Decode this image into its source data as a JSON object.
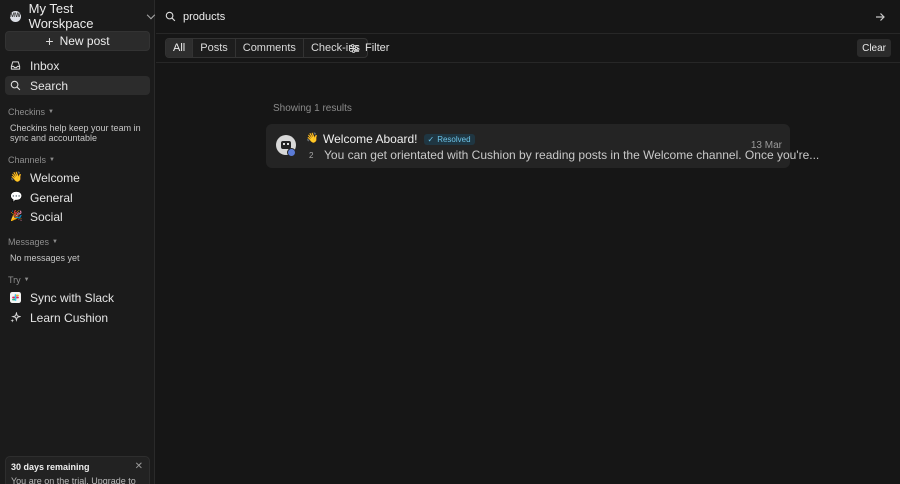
{
  "workspace": {
    "logo_text": "MW",
    "name": "My Test Worskpace"
  },
  "sidebar": {
    "new_post_label": "New post",
    "nav": [
      {
        "label": "Inbox",
        "icon": "inbox-icon"
      },
      {
        "label": "Search",
        "icon": "search-icon"
      }
    ],
    "checkins": {
      "heading": "Checkins",
      "note": "Checkins help keep your team in sync and accountable"
    },
    "channels": {
      "heading": "Channels",
      "items": [
        {
          "emoji": "👋",
          "label": "Welcome"
        },
        {
          "emoji": "💬",
          "label": "General"
        },
        {
          "emoji": "🎉",
          "label": "Social"
        }
      ]
    },
    "messages": {
      "heading": "Messages",
      "note": "No messages yet"
    },
    "try": {
      "heading": "Try",
      "items": [
        {
          "label": "Sync with Slack",
          "icon": "slack-icon"
        },
        {
          "label": "Learn Cushion",
          "icon": "sparkle-icon"
        }
      ]
    },
    "trial": {
      "title": "30 days remaining",
      "subtitle": "You are on the trial. Upgrade to Pro"
    }
  },
  "search": {
    "query": "products"
  },
  "filters": {
    "tabs": [
      "All",
      "Posts",
      "Comments",
      "Check-ins"
    ],
    "active_tab": "All",
    "filter_label": "Filter",
    "clear_label": "Clear"
  },
  "results": {
    "count_text": "Showing 1 results",
    "items": [
      {
        "emoji": "👋",
        "title": "Welcome Aboard!",
        "status": "Resolved",
        "reply_count": "2",
        "snippet": "You can get orientated with Cushion by reading posts in the Welcome channel. Once you're...",
        "date": "13 Mar"
      }
    ]
  },
  "colors": {
    "accent": "#6cc4e8",
    "background": "#161616",
    "sidebar": "#1b1b1b"
  }
}
